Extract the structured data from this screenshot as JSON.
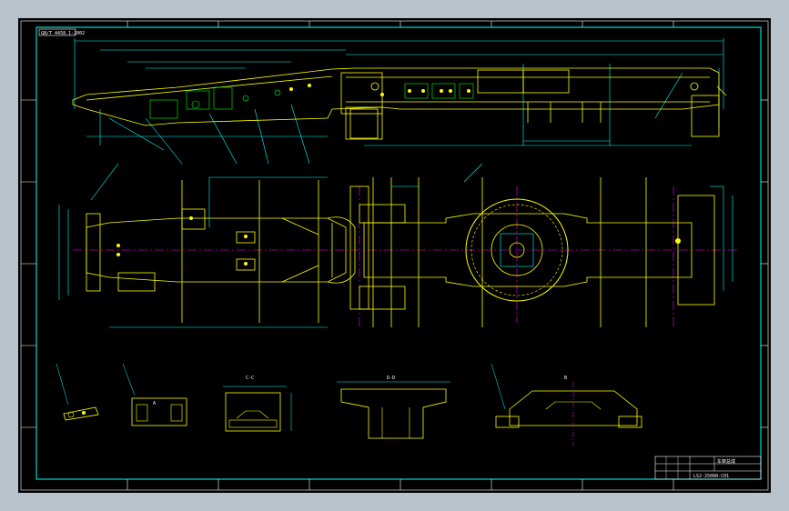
{
  "colors": {
    "background": "#000000",
    "border": "#00ffff",
    "part": "#ffff00",
    "dimension": "#00ffff",
    "centerline": "#ff00ff",
    "detail": "#00ff00",
    "annotation": "#ffffff"
  },
  "sheet": {
    "tag_top_left": "GB/T 4458.1-2002",
    "title_block": {
      "drawing_no": "LSJ-25000-C01",
      "drawing_name": "车架总成"
    }
  },
  "views": {
    "section_c": "C-C",
    "section_d": "D-D",
    "view_a": "A",
    "view_b": "B"
  }
}
